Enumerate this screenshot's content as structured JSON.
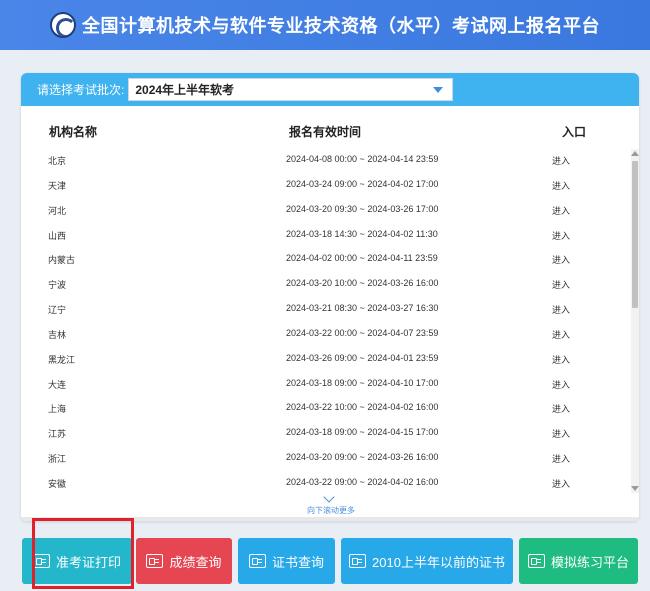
{
  "header": {
    "title": "全国计算机技术与软件专业技术资格（水平）考试网上报名平台"
  },
  "batch_select": {
    "label": "请选择考试批次:",
    "value": "2024年上半年软考"
  },
  "table": {
    "headers": {
      "name": "机构名称",
      "time": "报名有效时间",
      "entry": "入口"
    },
    "rows": [
      {
        "name": "北京",
        "time": "2024-04-08 00:00 ~ 2024-04-14 23:59",
        "entry": "进入"
      },
      {
        "name": "天津",
        "time": "2024-03-24 09:00 ~ 2024-04-02 17:00",
        "entry": "进入"
      },
      {
        "name": "河北",
        "time": "2024-03-20 09:30 ~ 2024-03-26 17:00",
        "entry": "进入"
      },
      {
        "name": "山西",
        "time": "2024-03-18 14:30 ~ 2024-04-02 11:30",
        "entry": "进入"
      },
      {
        "name": "内蒙古",
        "time": "2024-04-02 00:00 ~ 2024-04-11 23:59",
        "entry": "进入"
      },
      {
        "name": "宁波",
        "time": "2024-03-20 10:00 ~ 2024-03-26 16:00",
        "entry": "进入"
      },
      {
        "name": "辽宁",
        "time": "2024-03-21 08:30 ~ 2024-03-27 16:30",
        "entry": "进入"
      },
      {
        "name": "吉林",
        "time": "2024-03-22 00:00 ~ 2024-04-07 23:59",
        "entry": "进入"
      },
      {
        "name": "黑龙江",
        "time": "2024-03-26 09:00 ~ 2024-04-01 23:59",
        "entry": "进入"
      },
      {
        "name": "大连",
        "time": "2024-03-18 09:00 ~ 2024-04-10 17:00",
        "entry": "进入"
      },
      {
        "name": "上海",
        "time": "2024-03-22 10:00 ~ 2024-04-02 16:00",
        "entry": "进入"
      },
      {
        "name": "江苏",
        "time": "2024-03-18 09:00 ~ 2024-04-15 17:00",
        "entry": "进入"
      },
      {
        "name": "浙江",
        "time": "2024-03-20 09:00 ~ 2024-03-26 16:00",
        "entry": "进入"
      },
      {
        "name": "安徽",
        "time": "2024-03-22 09:00 ~ 2024-04-02 16:00",
        "entry": "进入"
      }
    ],
    "scroll_more": "向下滚动更多"
  },
  "buttons": [
    {
      "label": "准考证打印",
      "icon": "id-card-icon",
      "color": "#24b7cc"
    },
    {
      "label": "成绩查询",
      "icon": "search-document-icon",
      "color": "#e64552"
    },
    {
      "label": "证书查询",
      "icon": "certificate-search-icon",
      "color": "#27a8e8"
    },
    {
      "label": "2010上半年以前的证书",
      "icon": "certificate-search-icon",
      "color": "#27a8e8"
    },
    {
      "label": "模拟练习平台",
      "icon": "edit-document-icon",
      "color": "#1fbc82"
    }
  ],
  "highlight_color": "#e0202b"
}
